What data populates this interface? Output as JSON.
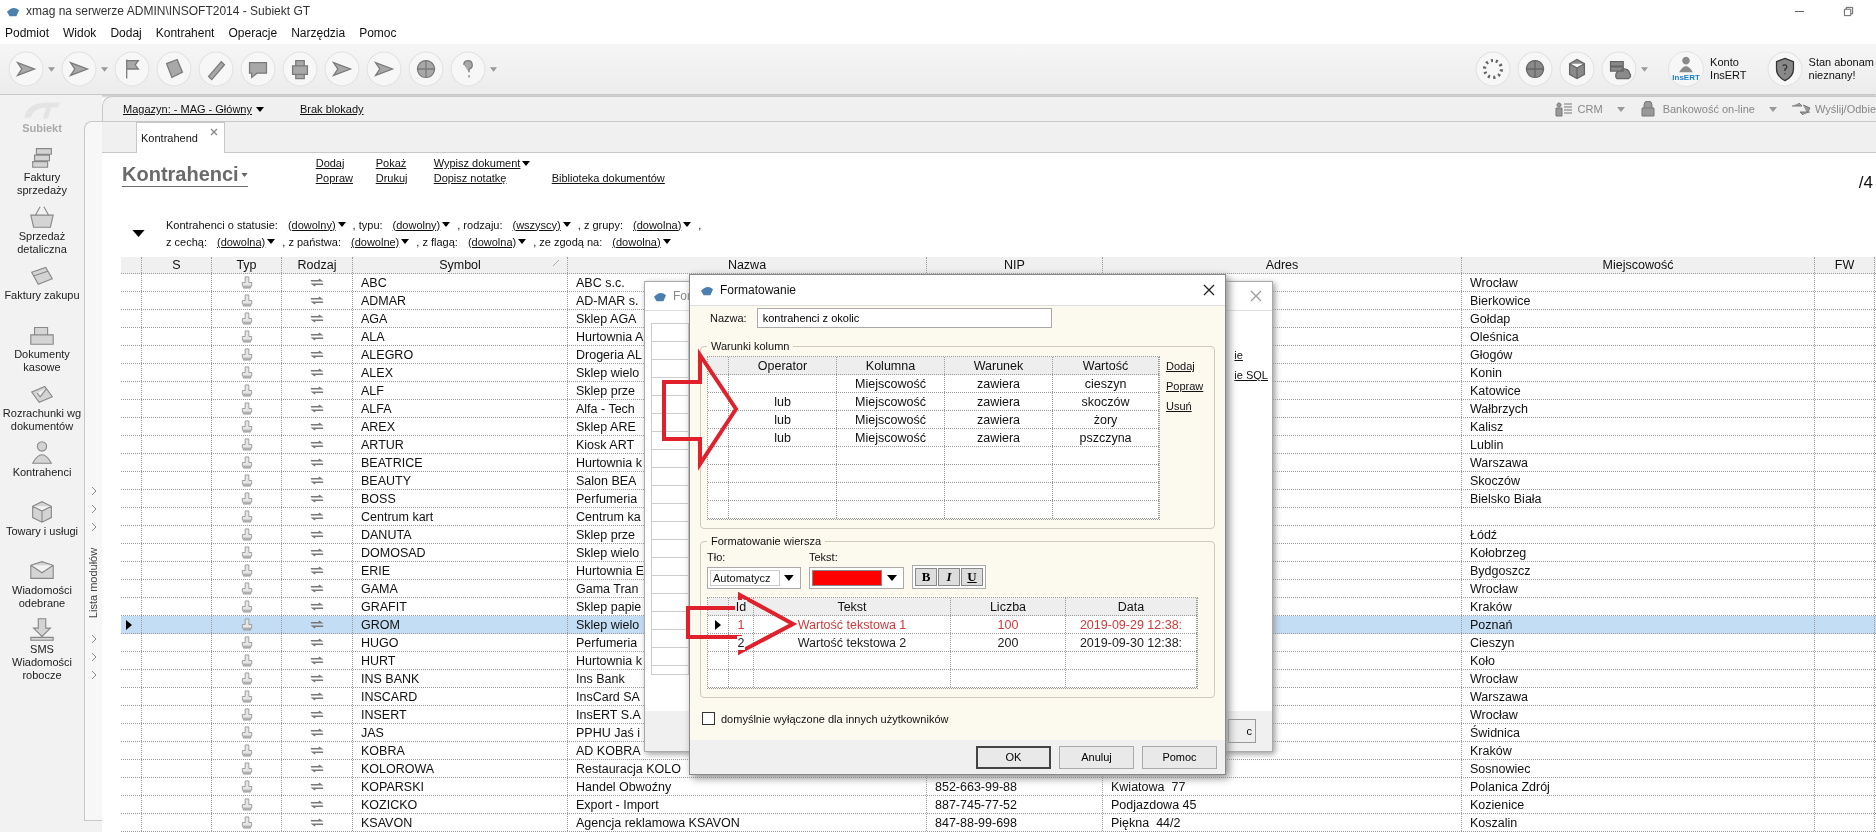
{
  "window": {
    "title": "xmag na serwerze ADMIN\\INSOFT2014 - Subiekt GT"
  },
  "menu": [
    "Podmiot",
    "Widok",
    "Dodaj",
    "Kontrahent",
    "Operacje",
    "Narzędzia",
    "Pomoc"
  ],
  "toolbar_right": {
    "account_badge": "InsERT",
    "account": [
      "Konto",
      "InsERT"
    ],
    "subscription": [
      "Stan abonam",
      "nieznany!"
    ]
  },
  "sidebar": {
    "logo": "Subiekt",
    "items": [
      "Faktury sprzedaży",
      "Sprzedaż detaliczna",
      "Faktury zakupu",
      "Dokumenty kasowe",
      "Rozrachunki wg dokumentów",
      "Kontrahenci",
      "Towary i usługi",
      "Wiadomości odebrane",
      "SMS Wiadomości robocze"
    ],
    "module_list": "Lista modułów"
  },
  "topbar": {
    "warehouse": "Magazyn: - MAG - Główny",
    "lock": "Brak blokady",
    "tools": [
      {
        "label": "CRM",
        "dropdown": true
      },
      {
        "label": "Bankowość on-line",
        "dropdown": true
      },
      {
        "label": "Wyślij/Odbie",
        "dropdown": false
      }
    ]
  },
  "tabs": [
    {
      "label": "Kontrahend",
      "selected": true
    }
  ],
  "page": {
    "title": "Kontrahenci",
    "counter": "/4",
    "actions": [
      [
        {
          "label": "Dodaj",
          "dropdown": false
        },
        {
          "label": "Pokaż",
          "dropdown": false
        },
        {
          "label": "Wypisz dokument",
          "dropdown": true
        }
      ],
      [
        {
          "label": "Popraw",
          "dropdown": false
        },
        {
          "label": "Drukuj",
          "dropdown": false
        },
        {
          "label": "Dopisz notatkę",
          "dropdown": false
        },
        {
          "label": "Biblioteka dokumentów",
          "dropdown": false
        }
      ]
    ]
  },
  "filters": [
    [
      {
        "label": "Kontrahenci o statusie:",
        "value": "(dowolny)"
      },
      {
        "label": ", typu:",
        "value": "(dowolny)"
      },
      {
        "label": ", rodzaju:",
        "value": "(wszyscy)"
      },
      {
        "label": ", z grupy:",
        "value": "(dowolna)"
      },
      {
        "label": ","
      }
    ],
    [
      {
        "label": "z cechą:",
        "value": "(dowolna)"
      },
      {
        "label": ", z państwa:",
        "value": "(dowolne)"
      },
      {
        "label": ", z flagą:",
        "value": "(dowolna)"
      },
      {
        "label": ", ze zgodą na:",
        "value": "(dowolna)"
      }
    ]
  ],
  "table": {
    "columns": [
      "S",
      "Typ",
      "Rodzaj",
      "Symbol",
      "Nazwa",
      "NIP",
      "Adres",
      "Miejscowość",
      "FW"
    ],
    "rows": [
      {
        "symbol": "ABC",
        "nazwa": "ABC s.c.",
        "miejscowosc": "Wrocław",
        "selected": false
      },
      {
        "symbol": "ADMAR",
        "nazwa": "AD-MAR s.",
        "miejscowosc": "Bierkowice",
        "selected": false
      },
      {
        "symbol": "AGA",
        "nazwa": "Sklep AGA",
        "miejscowosc": "Gołdap",
        "selected": false
      },
      {
        "symbol": "ALA",
        "nazwa": "Hurtownia A",
        "miejscowosc": "Oleśnica",
        "selected": false
      },
      {
        "symbol": "ALEGRO",
        "nazwa": "Drogeria AL",
        "miejscowosc": "Głogów",
        "selected": false
      },
      {
        "symbol": "ALEX",
        "nazwa": "Sklep wielo",
        "miejscowosc": "Konin",
        "selected": false
      },
      {
        "symbol": "ALF",
        "nazwa": "Sklep prze",
        "miejscowosc": "Katowice",
        "selected": false
      },
      {
        "symbol": "ALFA",
        "nazwa": "Alfa - Tech",
        "miejscowosc": "Wałbrzych",
        "selected": false
      },
      {
        "symbol": "AREX",
        "nazwa": "Sklep ARE",
        "miejscowosc": "Kalisz",
        "selected": false
      },
      {
        "symbol": "ARTUR",
        "nazwa": "Kiosk ART",
        "miejscowosc": "Lublin",
        "selected": false
      },
      {
        "symbol": "BEATRICE",
        "nazwa": "Hurtownia k",
        "miejscowosc": "Warszawa",
        "selected": false
      },
      {
        "symbol": "BEAUTY",
        "nazwa": "Salon BEA",
        "miejscowosc": "Skoczów",
        "selected": false
      },
      {
        "symbol": "BOSS",
        "nazwa": "Perfumeria",
        "miejscowosc": "Bielsko Biała",
        "selected": false
      },
      {
        "symbol": "Centrum kart",
        "nazwa": "Centrum ka",
        "selected": false
      },
      {
        "symbol": "DANUTA",
        "nazwa": "Sklep prze",
        "miejscowosc": "Łódź",
        "selected": false
      },
      {
        "symbol": "DOMOSAD",
        "nazwa": "Sklep wielo",
        "miejscowosc": "Kołobrzeg",
        "selected": false
      },
      {
        "symbol": "ERIE",
        "nazwa": "Hurtownia E",
        "miejscowosc": "Bydgoszcz",
        "selected": false
      },
      {
        "symbol": "GAMA",
        "nazwa": "Gama Tran",
        "miejscowosc": "Wrocław",
        "selected": false
      },
      {
        "symbol": "GRAFIT",
        "nazwa": "Sklep papie",
        "miejscowosc": "Kraków",
        "selected": false
      },
      {
        "symbol": "GROM",
        "nazwa": "Sklep wielo",
        "miejscowosc": "Poznań",
        "selected": true
      },
      {
        "symbol": "HUGO",
        "nazwa": "Perfumeria",
        "miejscowosc": "Cieszyn",
        "selected": false
      },
      {
        "symbol": "HURT",
        "nazwa": "Hurtownia k",
        "miejscowosc": "Koło",
        "selected": false
      },
      {
        "symbol": "INS BANK",
        "nazwa": "Ins Bank",
        "miejscowosc": "Wrocław",
        "selected": false
      },
      {
        "symbol": "INSCARD",
        "nazwa": "InsCard SA",
        "miejscowosc": "Warszawa",
        "selected": false
      },
      {
        "symbol": "INSERT",
        "nazwa": "InsERT S.A",
        "miejscowosc": "Wrocław",
        "selected": false
      },
      {
        "symbol": "JAS",
        "nazwa": "PPHU Jaś i",
        "miejscowosc": "Świdnica",
        "selected": false
      },
      {
        "symbol": "KOBRA",
        "nazwa": "AD KOBRA",
        "miejscowosc": "Kraków",
        "selected": false
      },
      {
        "symbol": "KOLOROWA",
        "nazwa": "Restauracja KOLO",
        "miejscowosc": "Sosnowiec",
        "selected": false
      },
      {
        "symbol": "KOPARSKI",
        "nazwa": "Handel Obwoźny",
        "nip": "852-663-99-88",
        "adres": "Kwiatowa  77",
        "miejscowosc": "Polanica Zdrój",
        "selected": false
      },
      {
        "symbol": "KOZICKO",
        "nazwa": "Export - Import",
        "nip": "887-745-77-52",
        "adres": "Podjazdowa 45",
        "miejscowosc": "Kozienice",
        "selected": false
      },
      {
        "symbol": "KSAVON",
        "nazwa": "Agencja reklamowa KSAVON",
        "nip": "847-88-99-698",
        "adres": "Piękna  44/2",
        "miejscowosc": "Koszalin",
        "selected": false
      }
    ]
  },
  "back_dialog": {
    "title": "For",
    "links": [
      "ie",
      "ie SQL"
    ],
    "button": "c"
  },
  "dialog": {
    "title": "Formatowanie",
    "name_label": "Nazwa:",
    "name_value": "kontrahenci z okolic",
    "conditions": {
      "title": "Warunki kolumn",
      "columns": [
        "Operator",
        "Kolumna",
        "Warunek",
        "Wartość"
      ],
      "rows": [
        {
          "column": "Miejscowość",
          "condition": "zawiera",
          "value": "cieszyn"
        },
        {
          "operator": "lub",
          "column": "Miejscowość",
          "condition": "zawiera",
          "value": "skoczów"
        },
        {
          "operator": "lub",
          "column": "Miejscowość",
          "condition": "zawiera",
          "value": "żory"
        },
        {
          "operator": "lub",
          "column": "Miejscowość",
          "condition": "zawiera",
          "value": "pszczyna"
        }
      ],
      "links": [
        "Dodaj",
        "Popraw",
        "Usuń"
      ]
    },
    "row_format": {
      "title": "Formatowanie wiersza",
      "background_label": "Tło:",
      "background_value": "Automatycz",
      "text_label": "Tekst:",
      "text_color": {
        "color": "#ff0000"
      },
      "style_buttons": [
        {
          "label": "B",
          "kind": "bold"
        },
        {
          "label": "I",
          "kind": "italic"
        },
        {
          "label": "U",
          "kind": "underline"
        }
      ],
      "preview": {
        "columns": [
          "Id",
          "Tekst",
          "Liczba",
          "Data"
        ],
        "rows": [
          {
            "id": "1",
            "text": "Wartość tekstowa 1",
            "number": "100",
            "date": "2019-09-29 12:38:",
            "selected": true,
            "color": "#d03a3a"
          },
          {
            "id": "2",
            "text": "Wartość tekstowa 2",
            "number": "200",
            "date": "2019-09-30 12:38:",
            "selected": false,
            "color": "#222222"
          }
        ]
      }
    },
    "checkbox": {
      "label": "domyślnie wyłączone dla innych użytkowników",
      "checked": false
    },
    "buttons": [
      "OK",
      "Anuluj",
      "Pomoc"
    ]
  }
}
